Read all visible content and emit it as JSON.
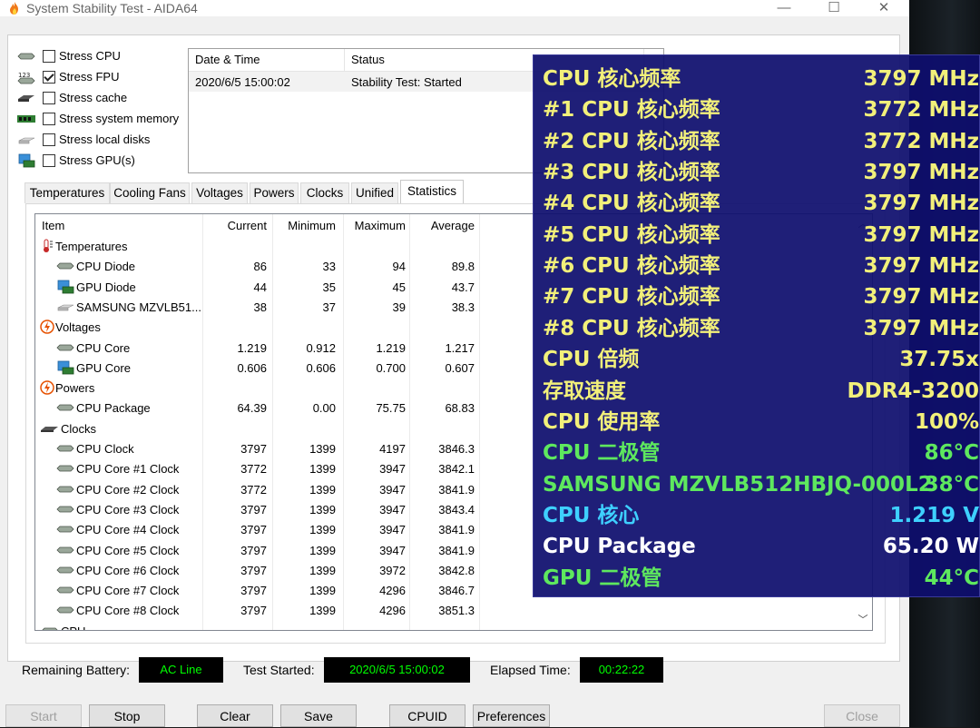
{
  "window": {
    "title": "System Stability Test - AIDA64",
    "min_glyph": "—",
    "max_glyph": "☐",
    "close_glyph": "✕"
  },
  "stress": [
    {
      "label": "Stress CPU",
      "checked": false,
      "icon": "cpu-chip-icon"
    },
    {
      "label": "Stress FPU",
      "checked": true,
      "icon": "fpu-123-icon"
    },
    {
      "label": "Stress cache",
      "checked": false,
      "icon": "cache-icon"
    },
    {
      "label": "Stress system memory",
      "checked": false,
      "icon": "memory-icon"
    },
    {
      "label": "Stress local disks",
      "checked": false,
      "icon": "disk-icon"
    },
    {
      "label": "Stress GPU(s)",
      "checked": false,
      "icon": "gpu-icon"
    }
  ],
  "log": {
    "col_datetime": "Date & Time",
    "col_status": "Status",
    "row_datetime": "2020/6/5 15:00:02",
    "row_status": "Stability Test: Started"
  },
  "tabs": [
    {
      "label": "Temperatures"
    },
    {
      "label": "Cooling Fans"
    },
    {
      "label": "Voltages"
    },
    {
      "label": "Powers"
    },
    {
      "label": "Clocks"
    },
    {
      "label": "Unified"
    },
    {
      "label": "Statistics",
      "active": true
    }
  ],
  "stats": {
    "headers": {
      "item": "Item",
      "current": "Current",
      "minimum": "Minimum",
      "maximum": "Maximum",
      "average": "Average"
    },
    "rows": [
      {
        "type": "group",
        "icon": "thermometer-icon",
        "label": "Temperatures"
      },
      {
        "type": "item",
        "icon": "cpu-chip-icon",
        "label": "CPU Diode",
        "current": "86",
        "minimum": "33",
        "maximum": "94",
        "average": "89.8"
      },
      {
        "type": "item",
        "icon": "gpu-icon",
        "label": "GPU Diode",
        "current": "44",
        "minimum": "35",
        "maximum": "45",
        "average": "43.7"
      },
      {
        "type": "item",
        "icon": "disk-icon",
        "label": "SAMSUNG MZVLB51...",
        "current": "38",
        "minimum": "37",
        "maximum": "39",
        "average": "38.3"
      },
      {
        "type": "group",
        "icon": "voltage-icon",
        "label": "Voltages"
      },
      {
        "type": "item",
        "icon": "cpu-chip-icon",
        "label": "CPU Core",
        "current": "1.219",
        "minimum": "0.912",
        "maximum": "1.219",
        "average": "1.217"
      },
      {
        "type": "item",
        "icon": "gpu-icon",
        "label": "GPU Core",
        "current": "0.606",
        "minimum": "0.606",
        "maximum": "0.700",
        "average": "0.607"
      },
      {
        "type": "group",
        "icon": "power-icon",
        "label": "Powers"
      },
      {
        "type": "item",
        "icon": "cpu-chip-icon",
        "label": "CPU Package",
        "current": "64.39",
        "minimum": "0.00",
        "maximum": "75.75",
        "average": "68.83"
      },
      {
        "type": "group",
        "icon": "clock-chip-icon",
        "label": "Clocks"
      },
      {
        "type": "item",
        "icon": "cpu-chip-icon",
        "label": "CPU Clock",
        "current": "3797",
        "minimum": "1399",
        "maximum": "4197",
        "average": "3846.3"
      },
      {
        "type": "item",
        "icon": "cpu-chip-icon",
        "label": "CPU Core #1 Clock",
        "current": "3772",
        "minimum": "1399",
        "maximum": "3947",
        "average": "3842.1"
      },
      {
        "type": "item",
        "icon": "cpu-chip-icon",
        "label": "CPU Core #2 Clock",
        "current": "3772",
        "minimum": "1399",
        "maximum": "3947",
        "average": "3841.9"
      },
      {
        "type": "item",
        "icon": "cpu-chip-icon",
        "label": "CPU Core #3 Clock",
        "current": "3797",
        "minimum": "1399",
        "maximum": "3947",
        "average": "3843.4"
      },
      {
        "type": "item",
        "icon": "cpu-chip-icon",
        "label": "CPU Core #4 Clock",
        "current": "3797",
        "minimum": "1399",
        "maximum": "3947",
        "average": "3841.9"
      },
      {
        "type": "item",
        "icon": "cpu-chip-icon",
        "label": "CPU Core #5 Clock",
        "current": "3797",
        "minimum": "1399",
        "maximum": "3947",
        "average": "3841.9"
      },
      {
        "type": "item",
        "icon": "cpu-chip-icon",
        "label": "CPU Core #6 Clock",
        "current": "3797",
        "minimum": "1399",
        "maximum": "3972",
        "average": "3842.8"
      },
      {
        "type": "item",
        "icon": "cpu-chip-icon",
        "label": "CPU Core #7 Clock",
        "current": "3797",
        "minimum": "1399",
        "maximum": "4296",
        "average": "3846.7"
      },
      {
        "type": "item",
        "icon": "cpu-chip-icon",
        "label": "CPU Core #8 Clock",
        "current": "3797",
        "minimum": "1399",
        "maximum": "4296",
        "average": "3851.3"
      },
      {
        "type": "group",
        "icon": "cpu-chip-icon",
        "label": "CPU"
      }
    ]
  },
  "bottom": {
    "battery_label": "Remaining Battery:",
    "battery_value": "AC Line",
    "started_label": "Test Started:",
    "started_value": "2020/6/5 15:00:02",
    "elapsed_label": "Elapsed Time:",
    "elapsed_value": "00:22:22"
  },
  "buttons": [
    {
      "key": "start",
      "label": "Start",
      "enabled": false
    },
    {
      "key": "stop",
      "label": "Stop",
      "enabled": true
    },
    {
      "key": "clear",
      "label": "Clear",
      "enabled": true
    },
    {
      "key": "save",
      "label": "Save",
      "enabled": true
    },
    {
      "key": "cpuid",
      "label": "CPUID",
      "enabled": true
    },
    {
      "key": "preferences",
      "label": "Preferences",
      "enabled": true
    },
    {
      "key": "close",
      "label": "Close",
      "enabled": false
    }
  ],
  "osd": {
    "rows": [
      {
        "label": "CPU 核心频率",
        "value": "3797 MHz",
        "color": "#f2f07a"
      },
      {
        "label": "#1 CPU 核心频率",
        "value": "3772 MHz",
        "color": "#f2f07a"
      },
      {
        "label": "#2 CPU 核心频率",
        "value": "3772 MHz",
        "color": "#f2f07a"
      },
      {
        "label": "#3 CPU 核心频率",
        "value": "3797 MHz",
        "color": "#f2f07a"
      },
      {
        "label": "#4 CPU 核心频率",
        "value": "3797 MHz",
        "color": "#f2f07a"
      },
      {
        "label": "#5 CPU 核心频率",
        "value": "3797 MHz",
        "color": "#f2f07a"
      },
      {
        "label": "#6 CPU 核心频率",
        "value": "3797 MHz",
        "color": "#f2f07a"
      },
      {
        "label": "#7 CPU 核心频率",
        "value": "3797 MHz",
        "color": "#f2f07a"
      },
      {
        "label": "#8 CPU 核心频率",
        "value": "3797 MHz",
        "color": "#f2f07a"
      },
      {
        "label": "CPU 倍频",
        "value": "37.75x",
        "color": "#f2f07a"
      },
      {
        "label": "存取速度",
        "value": "DDR4-3200",
        "color": "#f2f07a"
      },
      {
        "label": "CPU 使用率",
        "value": "100%",
        "color": "#f2f07a"
      },
      {
        "label": "CPU 二极管",
        "value": "86°C",
        "color": "#5ee85e"
      },
      {
        "label": "SAMSUNG MZVLB512HBJQ-000L2",
        "value": "38°C",
        "color": "#5ee85e"
      },
      {
        "label": "CPU 核心",
        "value": "1.219 V",
        "color": "#3ed0ff"
      },
      {
        "label": "CPU Package",
        "value": "65.20 W",
        "color": "#ffffff"
      },
      {
        "label": "GPU 二极管",
        "value": "44°C",
        "color": "#5ee85e"
      }
    ]
  },
  "colors": {
    "osd_bg": "#0e0e6e",
    "status_green": "#00ff00",
    "title_flame": "#f07a1a"
  }
}
